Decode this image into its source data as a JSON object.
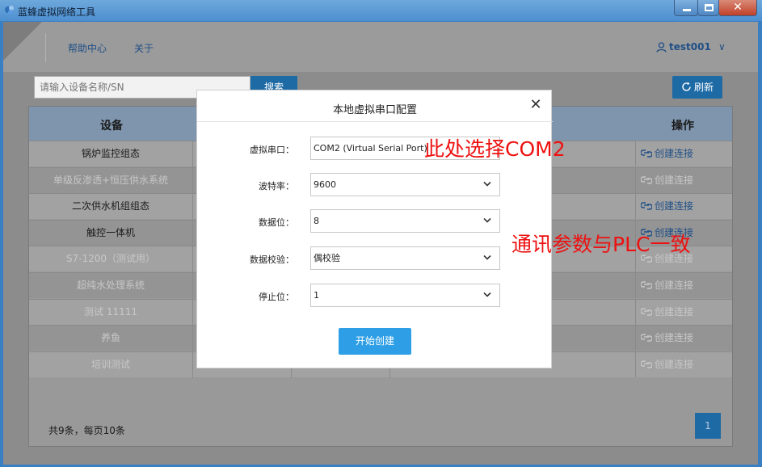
{
  "window": {
    "title": "蓝蜂虚拟网络工具",
    "close_glyph": "✕"
  },
  "nav": {
    "help": "帮助中心",
    "about": "关于",
    "user": "test001",
    "user_caret": "∨"
  },
  "toolbar": {
    "search_placeholder": "请输入设备名称/SN",
    "search_label": "搜索",
    "refresh_label": "刷新"
  },
  "table": {
    "headers": {
      "device": "设备",
      "action": "操作"
    },
    "rows": [
      {
        "name": "锅炉监控组态",
        "action": "创建连接",
        "state": "active"
      },
      {
        "name": "单级反渗透+恒压供水系统",
        "action": "创建连接",
        "state": "disabled"
      },
      {
        "name": "二次供水机组组态",
        "action": "创建连接",
        "state": "active"
      },
      {
        "name": "触控一体机",
        "action": "创建连接",
        "state": "active"
      },
      {
        "name": "S7-1200（测试用）",
        "action": "创建连接",
        "state": "disabled"
      },
      {
        "name": "超纯水处理系统",
        "action": "创建连接",
        "state": "disabled"
      },
      {
        "name": "测试 11111",
        "action": "创建连接",
        "state": "disabled"
      },
      {
        "name": "养鱼",
        "action": "创建连接",
        "state": "disabled"
      },
      {
        "name": "培训测试",
        "action": "创建连接",
        "state": "disabled"
      }
    ],
    "footer": "共9条，每页10条",
    "page": "1"
  },
  "modal": {
    "title": "本地虚拟串口配置",
    "close_glyph": "✕",
    "fields": [
      {
        "label": "虚拟串口：",
        "value": "COM2 (Virtual Serial Port)"
      },
      {
        "label": "波特率：",
        "value": "9600"
      },
      {
        "label": "数据位：",
        "value": "8"
      },
      {
        "label": "数据校验：",
        "value": "偶校验"
      },
      {
        "label": "停止位：",
        "value": "1"
      }
    ],
    "submit": "开始创建"
  },
  "annotations": {
    "com_note": "此处选择COM2",
    "param_note": "通讯参数与PLC一致"
  },
  "colors": {
    "accent": "#1d6aa5",
    "submit": "#2e9fe6",
    "annotation": "#ee1111"
  }
}
